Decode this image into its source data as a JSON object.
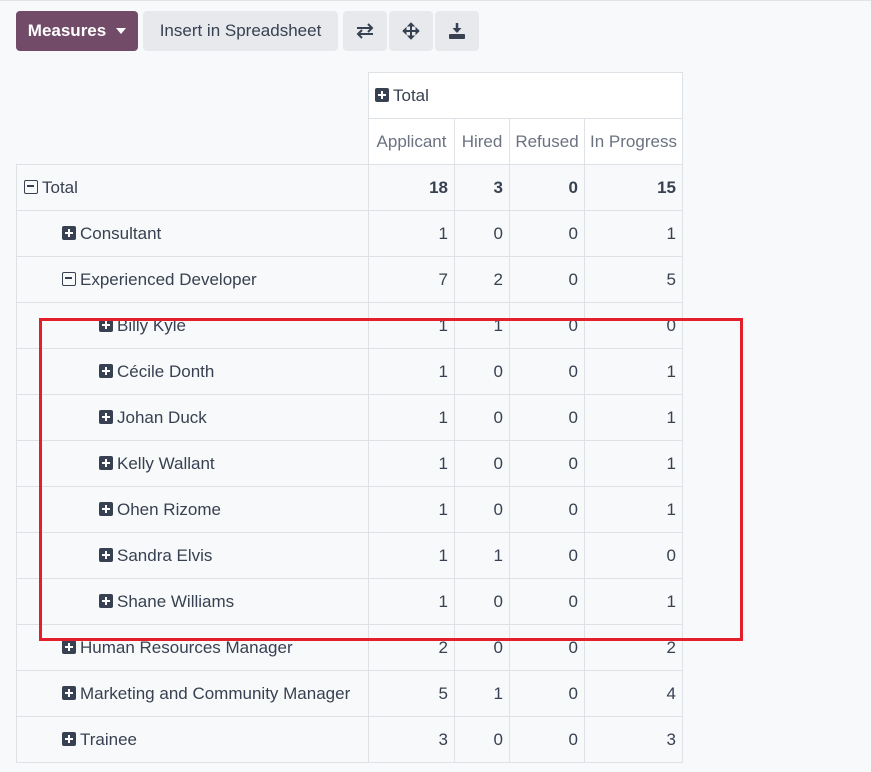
{
  "toolbar": {
    "measures_label": "Measures",
    "insert_label": "Insert in Spreadsheet",
    "flip_icon": "flip-axis-icon",
    "expand_icon": "expand-all-icon",
    "download_icon": "download-icon"
  },
  "pivot": {
    "column_group": "Total",
    "measures": [
      "Applicant",
      "Hired",
      "Refused",
      "In Progress"
    ],
    "rows": [
      {
        "label": "Total",
        "level": 0,
        "icon": "minus",
        "values": [
          "18",
          "3",
          "0",
          "15"
        ]
      },
      {
        "label": "Consultant",
        "level": 1,
        "icon": "plus",
        "values": [
          "1",
          "0",
          "0",
          "1"
        ]
      },
      {
        "label": "Experienced Developer",
        "level": 1,
        "icon": "minus",
        "values": [
          "7",
          "2",
          "0",
          "5"
        ]
      },
      {
        "label": "Billy Kyle",
        "level": 2,
        "icon": "plus",
        "values": [
          "1",
          "1",
          "0",
          "0"
        ]
      },
      {
        "label": "Cécile Donth",
        "level": 2,
        "icon": "plus",
        "values": [
          "1",
          "0",
          "0",
          "1"
        ]
      },
      {
        "label": "Johan Duck",
        "level": 2,
        "icon": "plus",
        "values": [
          "1",
          "0",
          "0",
          "1"
        ]
      },
      {
        "label": "Kelly Wallant",
        "level": 2,
        "icon": "plus",
        "values": [
          "1",
          "0",
          "0",
          "1"
        ]
      },
      {
        "label": "Ohen Rizome",
        "level": 2,
        "icon": "plus",
        "values": [
          "1",
          "0",
          "0",
          "1"
        ]
      },
      {
        "label": "Sandra Elvis",
        "level": 2,
        "icon": "plus",
        "values": [
          "1",
          "1",
          "0",
          "0"
        ]
      },
      {
        "label": "Shane Williams",
        "level": 2,
        "icon": "plus",
        "values": [
          "1",
          "0",
          "0",
          "1"
        ]
      },
      {
        "label": "Human Resources Manager",
        "level": 1,
        "icon": "plus",
        "values": [
          "2",
          "0",
          "0",
          "2"
        ]
      },
      {
        "label": "Marketing and Community Manager",
        "level": 1,
        "icon": "plus",
        "values": [
          "5",
          "1",
          "0",
          "4"
        ]
      },
      {
        "label": "Trainee",
        "level": 1,
        "icon": "plus",
        "values": [
          "3",
          "0",
          "0",
          "3"
        ]
      }
    ]
  },
  "colors": {
    "primary": "#714b67",
    "highlight": "#e3202a"
  }
}
